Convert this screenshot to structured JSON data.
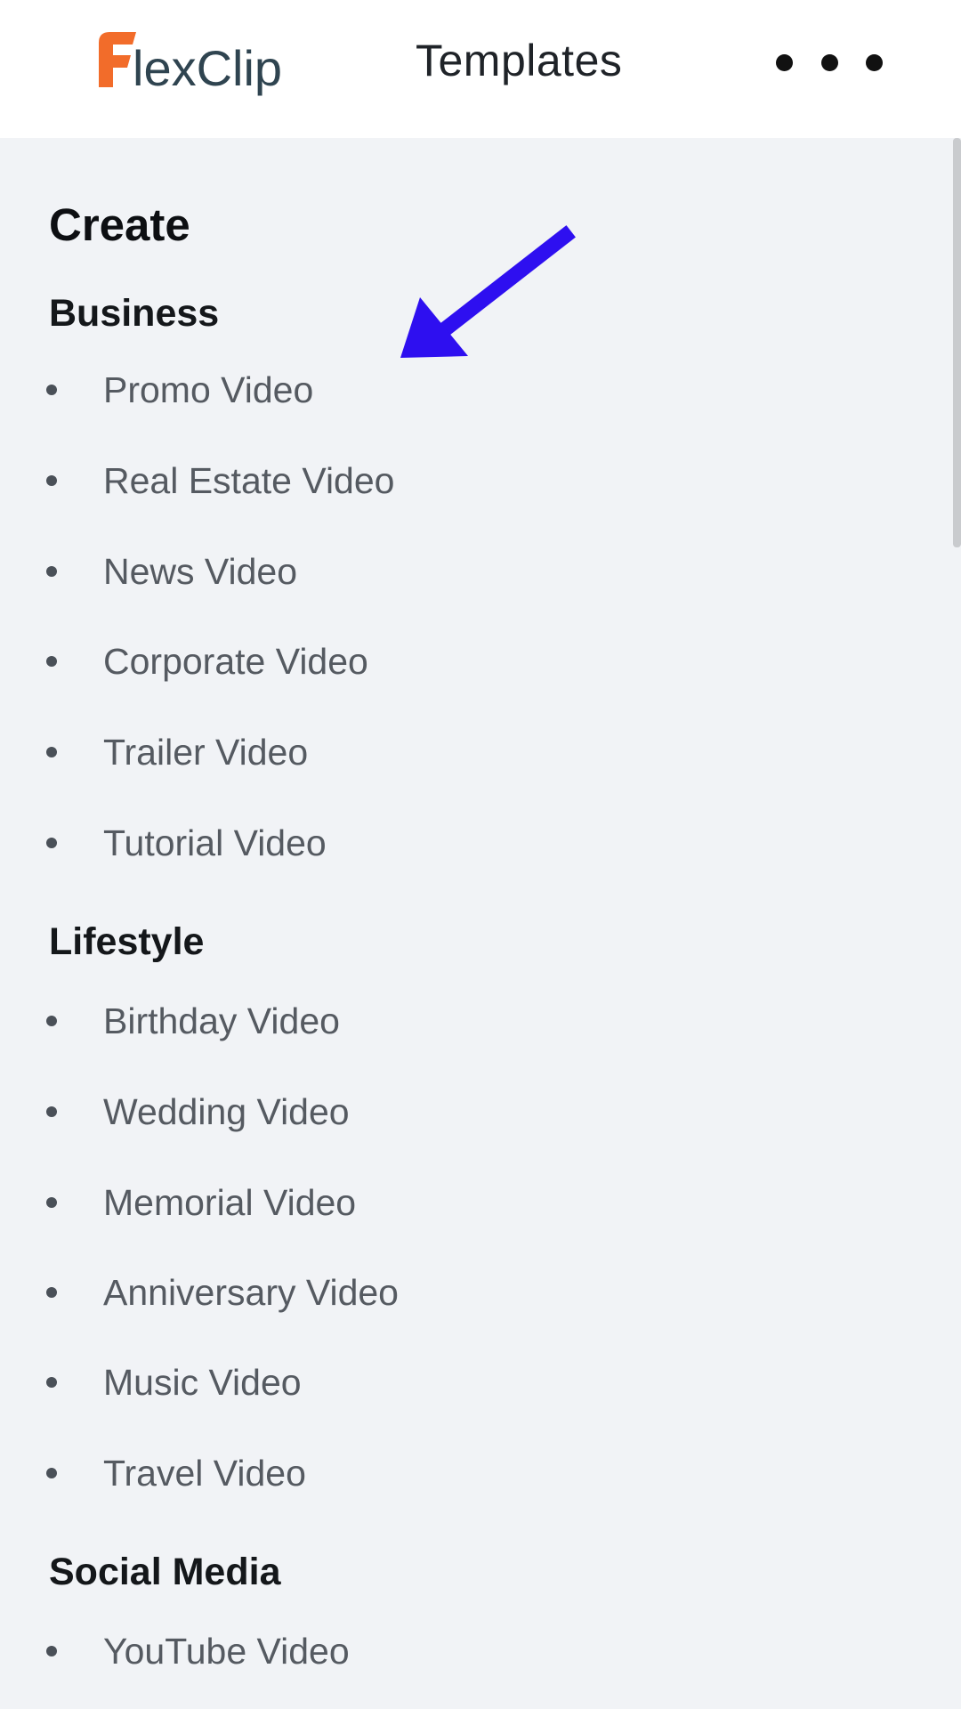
{
  "header": {
    "logo_text_part1": "F",
    "logo_text_part2": "lexClip",
    "title": "Templates",
    "more_icon": "more-horizontal-icon"
  },
  "colors": {
    "logo_orange": "#f26c2a",
    "logo_dark": "#2f4450",
    "annotation_arrow": "#2e0ff0",
    "background": "#f1f3f6"
  },
  "main": {
    "heading": "Create",
    "sections": [
      {
        "title": "Business",
        "items": [
          "Promo Video",
          "Real Estate Video",
          "News Video",
          "Corporate Video",
          "Trailer Video",
          "Tutorial Video"
        ]
      },
      {
        "title": "Lifestyle",
        "items": [
          "Birthday Video",
          "Wedding Video",
          "Memorial Video",
          "Anniversary Video",
          "Music Video",
          "Travel Video"
        ]
      },
      {
        "title": "Social Media",
        "items": [
          "YouTube Video"
        ]
      }
    ]
  }
}
